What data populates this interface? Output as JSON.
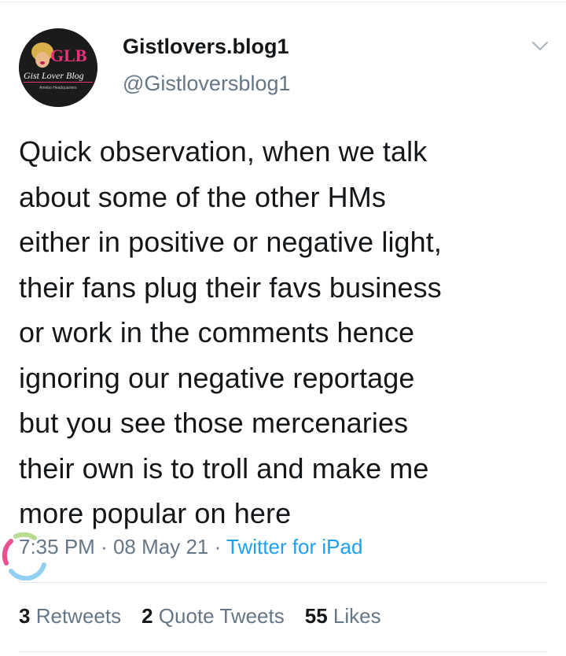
{
  "author": {
    "display_name": "Gistlovers.blog1",
    "handle": "@Gistloversblog1",
    "avatar_logo_text": "GLB",
    "avatar_logo_subtext": "Gist Lover Blog",
    "avatar_logo_tagline": "Amebo Headquarters"
  },
  "tweet": {
    "text_lines": [
      "Quick observation, when we talk",
      "about some of the other HMs",
      "either in positive or negative light,",
      "their fans plug their favs business",
      "or work in the comments hence",
      "ignoring our negative reportage",
      "but you see those mercenaries",
      "their own is to troll and make me",
      "more popular on here"
    ],
    "time": "7:35 PM",
    "separator": "·",
    "date": "08 May 21",
    "source": "Twitter for iPad"
  },
  "stats": {
    "retweets_count": "3",
    "retweets_label": "Retweets",
    "quotes_count": "2",
    "quotes_label": "Quote Tweets",
    "likes_count": "55",
    "likes_label": "Likes"
  },
  "icons": {
    "more_options": "chevron-down-icon",
    "loading": "loading-spinner-icon"
  },
  "colors": {
    "text_primary": "#14171a",
    "text_secondary": "#657786",
    "link": "#1da1f2",
    "divider": "#e1e8ed",
    "avatar_bg": "#1b1b1b",
    "logo_pink": "#e8337a"
  }
}
